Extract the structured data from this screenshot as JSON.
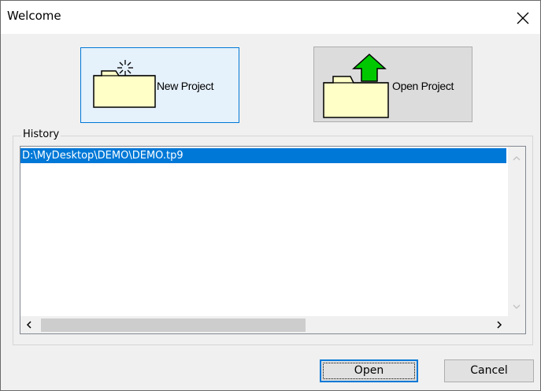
{
  "window": {
    "title": "Welcome"
  },
  "buttons": {
    "new_project_label": "New Project",
    "open_project_label": "Open Project",
    "open_label": "Open",
    "cancel_label": "Cancel"
  },
  "history": {
    "label": "History",
    "items": [
      {
        "path": "D:\\MyDesktop\\DEMO\\DEMO.tp9",
        "selected": true
      }
    ]
  },
  "icons": {
    "close": "close-icon",
    "new_project": "new-folder-icon",
    "open_project": "open-folder-icon"
  },
  "colors": {
    "selection": "#0078d7",
    "folder_fill": "#ffffc8",
    "arrow_green": "#00c800"
  }
}
